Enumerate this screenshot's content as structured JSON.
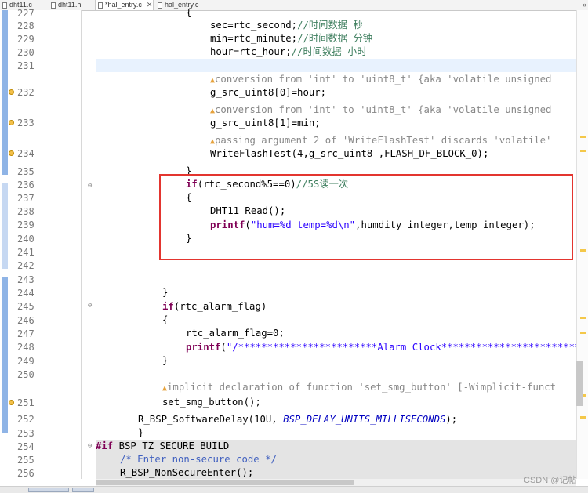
{
  "tabs": [
    {
      "label": "dht11.c",
      "active": false
    },
    {
      "label": "dht11.h",
      "active": false
    },
    {
      "label": "*hal_entry.c",
      "active": true,
      "close": "✕"
    },
    {
      "label": "hal_entry.c",
      "active": false
    }
  ],
  "tab_overflow": "»",
  "lines": [
    "227",
    "228",
    "229",
    "230",
    "231",
    "232",
    "233",
    "234",
    "235",
    "236",
    "237",
    "238",
    "239",
    "240",
    "241",
    "242",
    "243",
    "244",
    "245",
    "246",
    "247",
    "248",
    "249",
    "250",
    "251",
    "252",
    "253",
    "254",
    "255",
    "256"
  ],
  "code": {
    "l227": "{",
    "l228_a": "sec=rtc_second;",
    "l228_c": "//时间数据 秒",
    "l229_a": "min=rtc_minute;",
    "l229_c": "//时间数据 分钟",
    "l230_a": "hour=rtc_hour;",
    "l230_c": "//时间数据 小时",
    "w1": "conversion from 'int' to 'uint8_t' {aka 'volatile unsigned",
    "l232": "g_src_uint8[0]=hour;",
    "w2": "conversion from 'int' to 'uint8_t' {aka 'volatile unsigned",
    "l233": "g_src_uint8[1]=min;",
    "w3": "passing argument 2 of 'WriteFlashTest' discards 'volatile'",
    "l234": "WriteFlashTest(4,g_src_uint8 ,FLASH_DF_BLOCK_0);",
    "l235": "}",
    "l236_kw": "if",
    "l236_a": "(rtc_second%5==0)",
    "l236_c": "//5S读一次",
    "l237": "{",
    "l238": "DHT11_Read();",
    "l239_kw": "printf",
    "l239_a": "(",
    "l239_s": "\"hum=%d temp=%d\\n\"",
    "l239_b": ",humdity_integer,temp_integer);",
    "l240": "}",
    "l244": "}",
    "l245_kw": "if",
    "l245_a": "(rtc_alarm_flag)",
    "l246": "{",
    "l247": "rtc_alarm_flag=0;",
    "l248_kw": "printf",
    "l248_a": "(",
    "l248_s": "\"/************************Alarm Clock*************************",
    "l249": "}",
    "w4": "implicit declaration of function 'set_smg_button' [-Wimplicit-funct",
    "l251": "set_smg_button();",
    "l252_a": "R_BSP_SoftwareDelay(10U, ",
    "l252_c": "BSP_DELAY_UNITS_MILLISECONDS",
    "l252_b": ");",
    "l253": "}",
    "l254_kw": "#if",
    "l254_a": " BSP_TZ_SECURE_BUILD",
    "l255": "/* Enter non-secure code */",
    "l256": "R_BSP_NonSecureEnter();"
  },
  "warning_icon": "warning-icon",
  "watermark": "CSDN @记帖",
  "colors": {
    "highlight_box": "#e3352f",
    "keyword": "#7f0055",
    "string": "#2a00ff",
    "comment": "#3f7f5f"
  }
}
